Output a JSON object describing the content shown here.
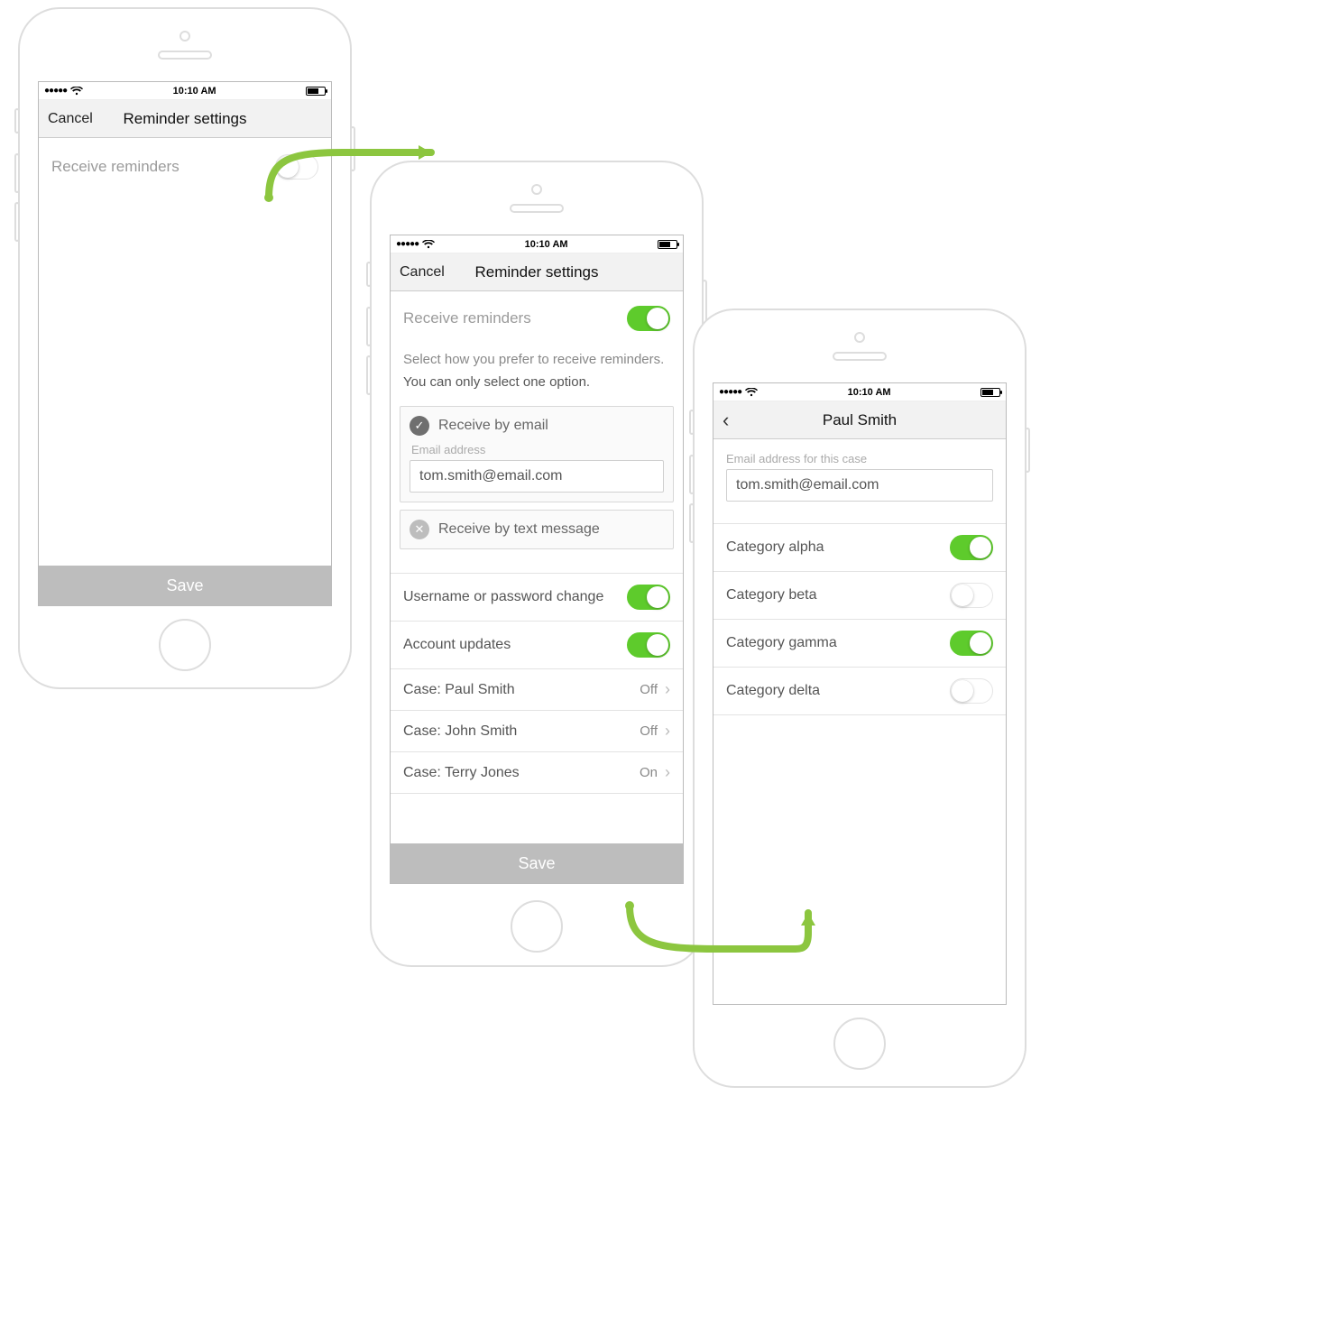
{
  "status": {
    "time": "10:10 AM"
  },
  "colors": {
    "accent": "#5ecb2c",
    "connector": "#8cc63f"
  },
  "screen1": {
    "nav": {
      "cancel": "Cancel",
      "title": "Reminder settings"
    },
    "receive_label": "Receive reminders",
    "receive_on": false,
    "save": "Save"
  },
  "screen2": {
    "nav": {
      "cancel": "Cancel",
      "title": "Reminder settings"
    },
    "receive_label": "Receive reminders",
    "receive_on": true,
    "helper1": "Select how you prefer to receive reminders.",
    "helper2": "You can only select one option.",
    "option_email": {
      "title": "Receive by email",
      "selected": true,
      "field_label": "Email address",
      "value": "tom.smith@email.com"
    },
    "option_sms": {
      "title": "Receive by text message",
      "selected": false
    },
    "toggles": [
      {
        "label": "Username or password change",
        "on": true
      },
      {
        "label": "Account updates",
        "on": true
      }
    ],
    "cases_prefix": "Case:",
    "cases": [
      {
        "name": "Paul Smith",
        "value": "Off"
      },
      {
        "name": "John Smith",
        "value": "Off"
      },
      {
        "name": "Terry Jones",
        "value": "On"
      }
    ],
    "save": "Save"
  },
  "screen3": {
    "nav": {
      "title": "Paul Smith"
    },
    "field_label": "Email address for this case",
    "email": "tom.smith@email.com",
    "categories": [
      {
        "label": "Category alpha",
        "on": true
      },
      {
        "label": "Category beta",
        "on": false
      },
      {
        "label": "Category gamma",
        "on": true
      },
      {
        "label": "Category delta",
        "on": false
      }
    ]
  }
}
